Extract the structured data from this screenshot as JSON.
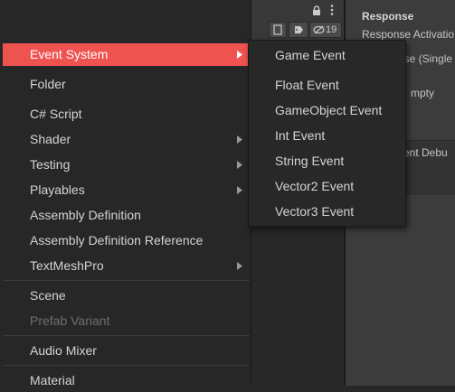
{
  "inspector": {
    "title": "Response",
    "line1": "Response Activatio",
    "line2": "ise (Single",
    "line3": "mpty",
    "line4": "vent Debu"
  },
  "toolbar": {
    "visibility_count": "19"
  },
  "menu": {
    "items": [
      {
        "label": "Event System",
        "has_submenu": true,
        "highlighted": true
      },
      {
        "label": "Folder"
      },
      {
        "label": "C# Script"
      },
      {
        "label": "Shader",
        "has_submenu": true
      },
      {
        "label": "Testing",
        "has_submenu": true
      },
      {
        "label": "Playables",
        "has_submenu": true
      },
      {
        "label": "Assembly Definition"
      },
      {
        "label": "Assembly Definition Reference"
      },
      {
        "label": "TextMeshPro",
        "has_submenu": true
      },
      {
        "label": "Scene"
      },
      {
        "label": "Prefab Variant",
        "disabled": true
      },
      {
        "label": "Audio Mixer"
      },
      {
        "label": "Material"
      }
    ],
    "highlight_color": "#ef5350"
  },
  "submenu": {
    "items": [
      {
        "label": "Game Event"
      },
      {
        "label": "Float Event"
      },
      {
        "label": "GameObject Event"
      },
      {
        "label": "Int Event"
      },
      {
        "label": "String Event"
      },
      {
        "label": "Vector2 Event"
      },
      {
        "label": "Vector3 Event"
      }
    ]
  }
}
